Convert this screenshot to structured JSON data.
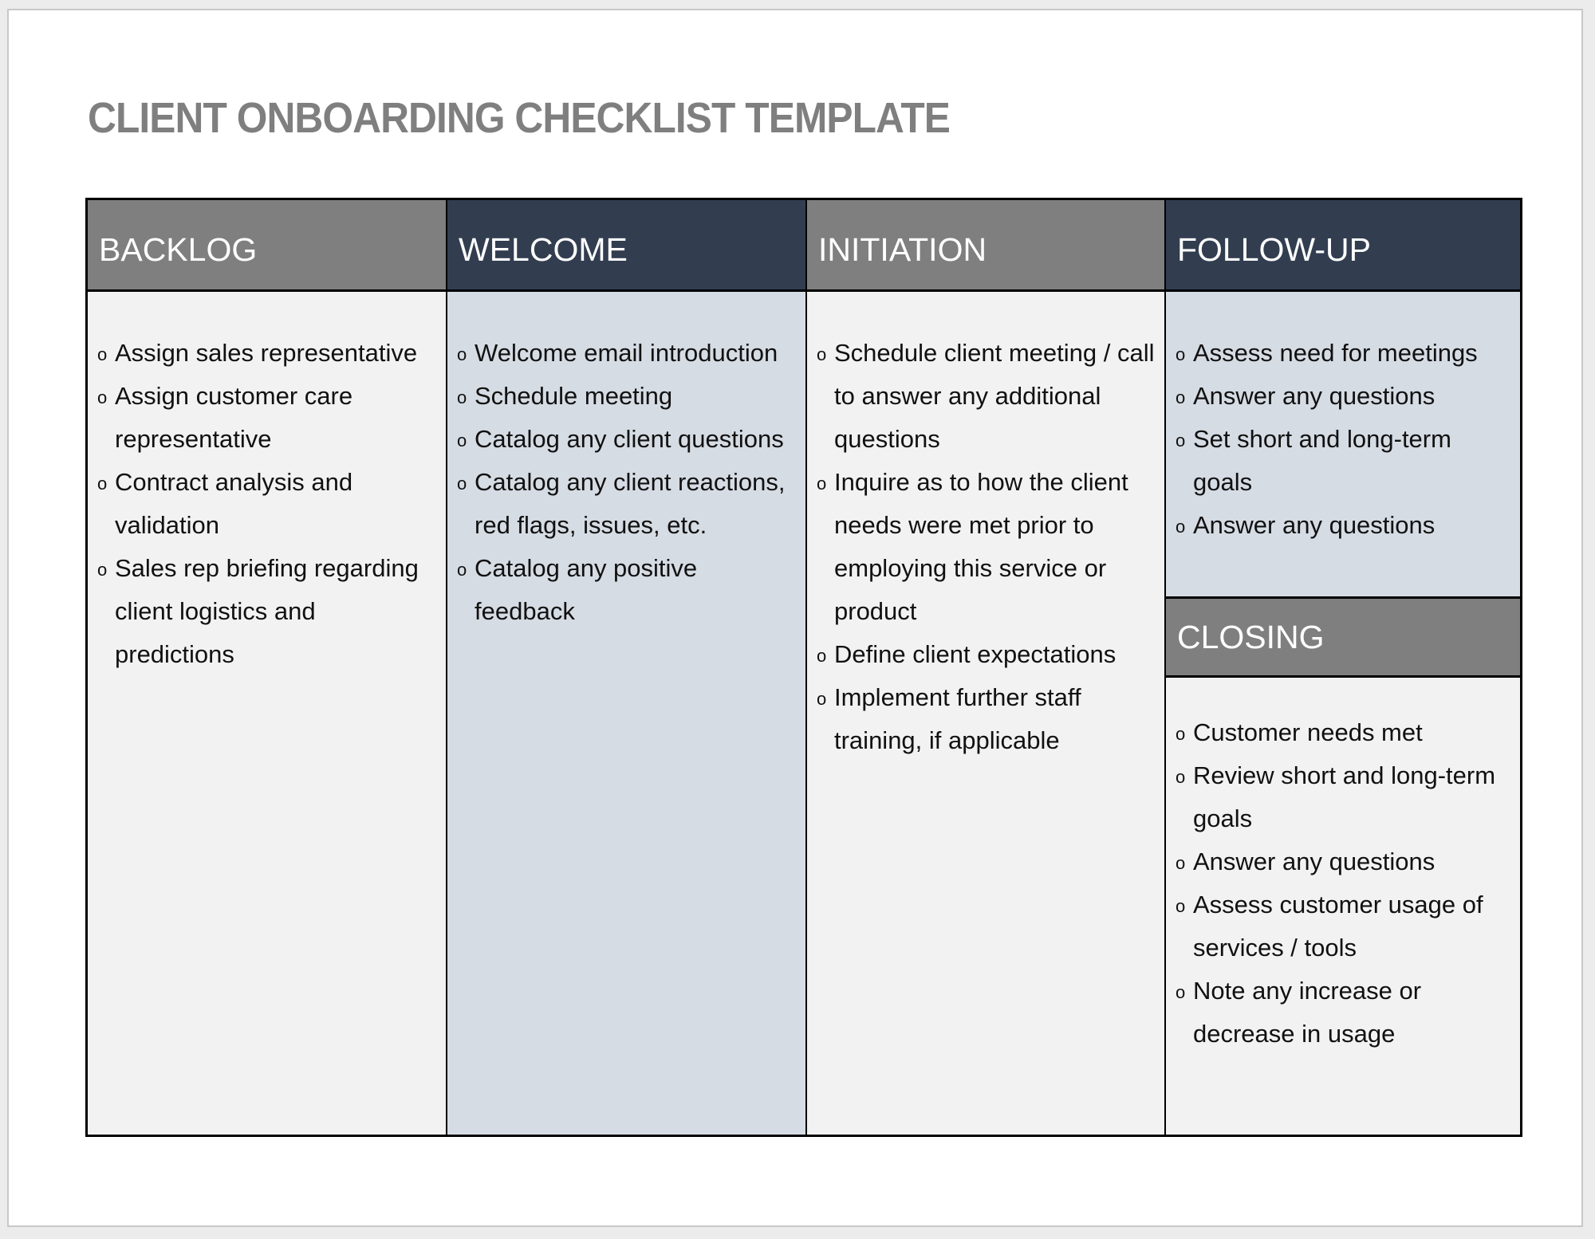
{
  "document": {
    "title": "CLIENT ONBOARDING CHECKLIST TEMPLATE"
  },
  "colors": {
    "header_gray": "#7f7f7f",
    "header_navy": "#323e50",
    "body_light": "#f2f2f2",
    "body_blue": "#d6dce4",
    "title_gray": "#7f7f7f"
  },
  "bullet_icon": "o",
  "columns": [
    {
      "heading": "BACKLOG",
      "items": [
        "Assign sales representative",
        "Assign customer care representative",
        "Contract analysis and validation",
        "Sales rep briefing regarding client logistics and predictions"
      ]
    },
    {
      "heading": "WELCOME",
      "items": [
        "Welcome email introduction",
        "Schedule meeting",
        "Catalog any client questions",
        "Catalog any client reactions, red flags, issues, etc.",
        "Catalog any positive feedback"
      ]
    },
    {
      "heading": "INITIATION",
      "items": [
        "Schedule client meeting / call to answer any additional questions",
        "Inquire as to how the client needs were met prior to employing this service or product",
        "Define client expectations",
        "Implement further staff training, if applicable"
      ]
    },
    {
      "heading": "FOLLOW-UP",
      "items": [
        "Assess need for meetings",
        "Answer any questions",
        "Set short and long-term goals",
        "Answer any questions"
      ]
    },
    {
      "heading": "CLOSING",
      "items": [
        "Customer needs met",
        "Review short and long-term goals",
        "Answer any questions",
        "Assess customer usage of services / tools",
        "Note any increase or decrease in usage"
      ]
    }
  ]
}
